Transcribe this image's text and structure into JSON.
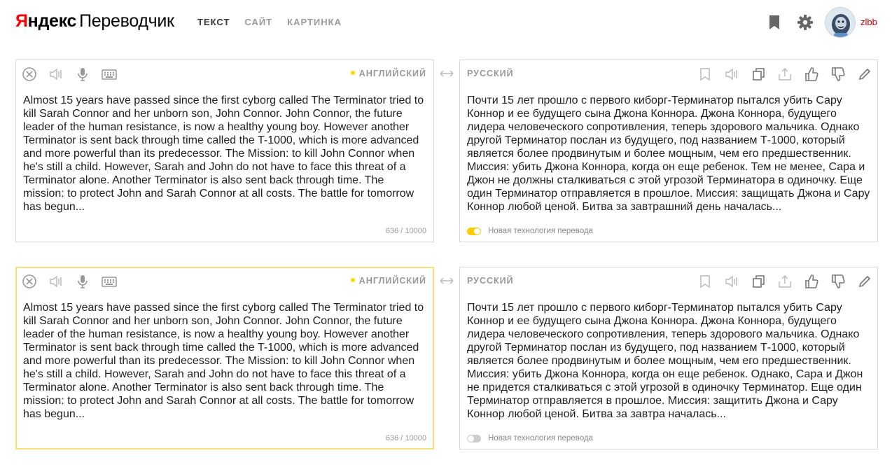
{
  "header": {
    "logo_y": "Я",
    "logo_brand": "ндекс",
    "logo_service": "Переводчик",
    "nav": [
      {
        "label": "ТЕКСТ",
        "active": true
      },
      {
        "label": "САЙТ",
        "active": false
      },
      {
        "label": "КАРТИНКА",
        "active": false
      }
    ],
    "icons": [
      "bookmark-icon",
      "gear-icon"
    ],
    "username": "zlbb"
  },
  "colors": {
    "logo_red": "#ff0000",
    "accent_yellow": "#ffcc00",
    "focus_border": "#f8df7a",
    "username": "#cc0000"
  },
  "panels": [
    {
      "source_lang": "АНГЛИЙСКИЙ",
      "target_lang": "РУССКИЙ",
      "source_text": "Almost 15 years have passed since the first cyborg called The Terminator tried to kill Sarah Connor and her unborn son, John Connor. John Connor, the future leader of the human resistance, is now a healthy young boy. However another Terminator is sent back through time called the T-1000, which is more advanced and more powerful than its predecessor. The Mission: to kill John Connor when he's still a child. However, Sarah and John do not have to face this threat of a Terminator alone. Another Terminator is also sent back through time. The mission: to protect John and Sarah Connor at all costs. The battle for tomorrow has begun...",
      "counter": "636 / 10000",
      "translation": "Почти 15 лет прошло с первого киборг-Терминатор пытался убить Сару Коннор и ее будущего сына Джона Коннора. Джона Коннора, будущего лидера человеческого сопротивления, теперь здорового мальчика. Однако другой Терминатор послан из будущего, под названием Т-1000, который является более продвинутым и более мощным, чем его предшественник. Миссия: убить Джона Коннора, когда он еще ребенок. Тем не менее, Сара и Джон не должны сталкиваться с этой угрозой Терминатора в одиночку. Еще один Терминатор отправляется в прошлое. Миссия: защищать Джона и Сару Коннор любой ценой. Битва за завтрашний день началась...",
      "tech_label": "Новая технология перевода",
      "tech_on": true
    },
    {
      "source_lang": "АНГЛИЙСКИЙ",
      "target_lang": "РУССКИЙ",
      "source_text": "Almost 15 years have passed since the first cyborg called The Terminator tried to kill Sarah Connor and her unborn son, John Connor. John Connor, the future leader of the human resistance, is now a healthy young boy. However another Terminator is sent back through time called the T-1000, which is more advanced and more powerful than its predecessor. The Mission: to kill John Connor when he's still a child. However, Sarah and John do not have to face this threat of a Terminator alone. Another Terminator is also sent back through time. The mission: to protect John and Sarah Connor at all costs. The battle for tomorrow has begun...",
      "counter": "636 / 10000",
      "translation": "Почти 15 лет прошло с первого киборг-Терминатор пытался убить Сару Коннор и ее будущего сына Джона Коннора. Джона Коннора, будущего лидера человеческого сопротивления, теперь здорового мальчика. Однако другой Терминатор послан из будущего, под названием Т-1000, который является более продвинутым и более мощным, чем его предшественник. Миссия: убить Джона Коннора, когда он еще ребенок. Однако, Сара и Джон не придется сталкиваться с этой угрозой в одиночку Терминатор. Еще один Терминатор отправляется в прошлое. Миссия: защитить Джона и Сару Коннор любой ценой. Битва за завтра началась...",
      "tech_label": "Новая технология перевода",
      "tech_on": false
    }
  ],
  "toolbar_icons": {
    "source": [
      "clear-icon",
      "speaker-icon",
      "microphone-icon",
      "keyboard-icon"
    ],
    "target": [
      "bookmark-icon",
      "speaker-icon",
      "copy-icon",
      "share-icon",
      "thumbs-up-icon",
      "thumbs-down-icon",
      "edit-icon"
    ]
  }
}
